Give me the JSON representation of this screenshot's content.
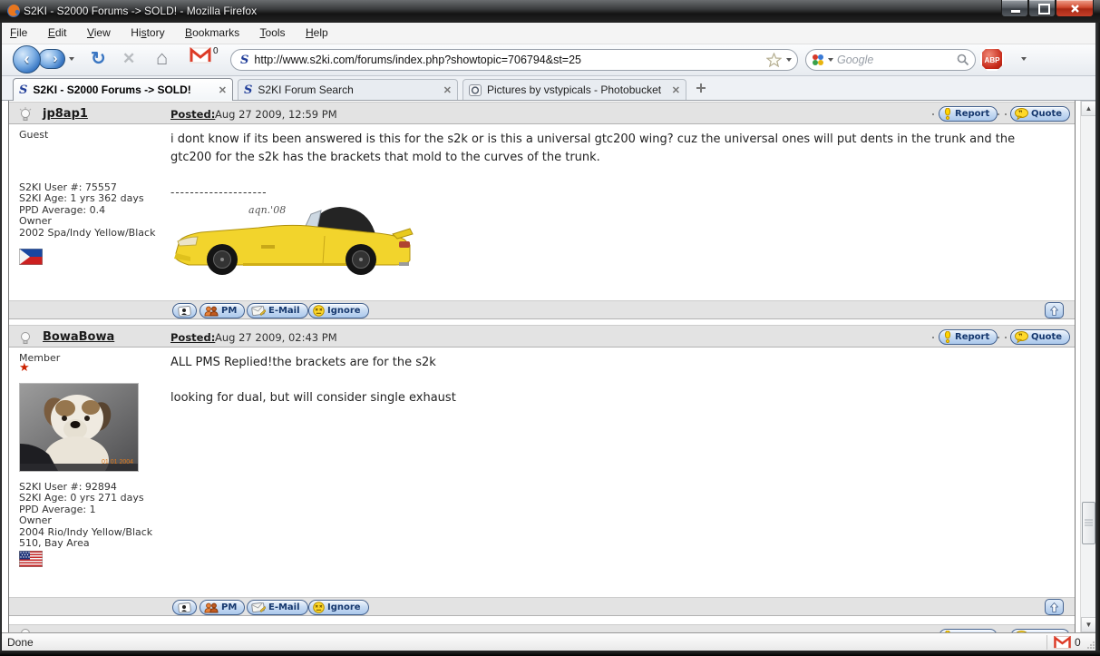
{
  "window": {
    "title": "S2KI - S2000 Forums -> SOLD! - Mozilla Firefox"
  },
  "menu": {
    "items": [
      {
        "label": "File",
        "accel": 0
      },
      {
        "label": "Edit",
        "accel": 0
      },
      {
        "label": "View",
        "accel": 0
      },
      {
        "label": "History",
        "accel": 2
      },
      {
        "label": "Bookmarks",
        "accel": 0
      },
      {
        "label": "Tools",
        "accel": 0
      },
      {
        "label": "Help",
        "accel": 0
      }
    ]
  },
  "toolbar": {
    "url": "http://www.s2ki.com/forums/index.php?showtopic=706794&st=25",
    "search_placeholder": "Google",
    "gmail_count": "0",
    "abp_label": "ABP"
  },
  "tabs": [
    {
      "label": "S2KI - S2000 Forums -> SOLD!"
    },
    {
      "label": "S2KI Forum Search"
    },
    {
      "label": "Pictures by vstypicals - Photobucket"
    }
  ],
  "post_buttons": {
    "report": "Report",
    "quote": "Quote",
    "pm": "PM",
    "email": "E-Mail",
    "ignore": "Ignore"
  },
  "posts": [
    {
      "username": "jp8ap1",
      "posted_label": "Posted:",
      "posted_date": "Aug 27 2009, 12:59 PM",
      "member_title": "Guest",
      "body": "i dont know if its been answered is this for the s2k or is this a universal gtc200 wing? cuz the universal ones will put dents in the trunk and the gtc200 for the s2k has the brackets that mold to the curves of the trunk.",
      "sig_dashes": "--------------------",
      "sig_artist": "aqn.'08",
      "stats": [
        "S2KI User #: 75557",
        "S2KI Age: 1 yrs 362 days",
        "PPD Average: 0.4",
        "Owner",
        "2002 Spa/Indy Yellow/Black"
      ],
      "flag": "philippines"
    },
    {
      "username": "BowaBowa",
      "posted_label": "Posted:",
      "posted_date": "Aug 27 2009, 02:43 PM",
      "member_title": "Member",
      "body_line1": "ALL PMS Replied!the brackets are for the s2k",
      "body_line2": "looking for dual, but will consider single exhaust",
      "avatar_datestamp": "01 01 2004",
      "stats": [
        "S2KI User #: 92894",
        "S2KI Age: 0 yrs 271 days",
        "PPD Average: 1",
        "Owner",
        "2004 Rio/Indy Yellow/Black",
        "510, Bay Area"
      ],
      "flag": "usa"
    }
  ],
  "statusbar": {
    "text": "Done",
    "gmail_count": "0"
  },
  "colors": {
    "forum_row_gray": "#e3e3e3",
    "pill_blue": "#c9dcf3",
    "pill_border": "#44628f",
    "car_yellow": "#f2d42c",
    "close_button_red": "#c62818",
    "member_star_red": "#cc2200"
  }
}
